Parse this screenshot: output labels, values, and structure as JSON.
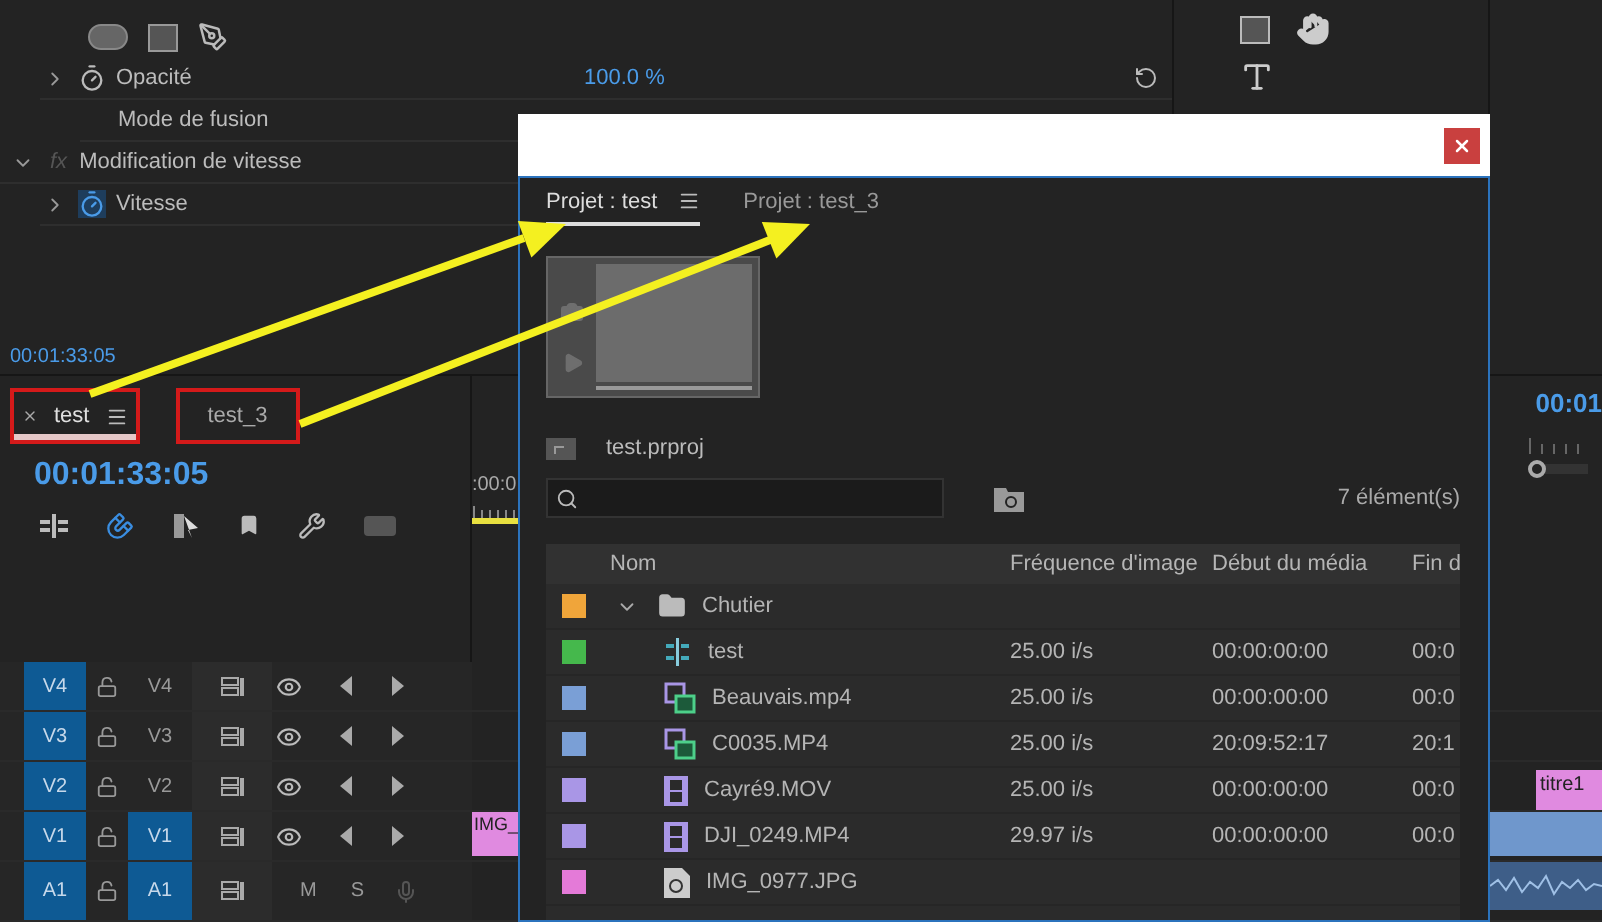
{
  "effect_controls": {
    "rows": [
      {
        "kind": "shapes"
      },
      {
        "kind": "param",
        "label": "Opacité",
        "value": "100.0 %",
        "expanded": false,
        "animated": false
      },
      {
        "kind": "plain",
        "label": "Mode de fusion"
      },
      {
        "kind": "effect",
        "badge": "fx",
        "label": "Modification de vitesse",
        "expanded": true
      },
      {
        "kind": "param",
        "label": "Vitesse",
        "expanded": false,
        "animated": true
      }
    ],
    "timecode": "00:01:33:05"
  },
  "timeline": {
    "tabs": [
      {
        "label": "test",
        "selected": true
      },
      {
        "label": "test_3",
        "selected": false
      }
    ],
    "timecode": "00:01:33:05",
    "ruler": ":00:0",
    "tracks": [
      {
        "kind": "video",
        "source": "V4",
        "name": "V4",
        "targeted": false
      },
      {
        "kind": "video",
        "source": "V3",
        "name": "V3",
        "targeted": false
      },
      {
        "kind": "video",
        "source": "V2",
        "name": "V2",
        "targeted": false
      },
      {
        "kind": "video",
        "source": "V1",
        "name": "V1",
        "targeted": true
      },
      {
        "kind": "audio",
        "source": "A1",
        "name": "A1",
        "targeted": true,
        "mute": "M",
        "solo": "S"
      }
    ],
    "clip": "IMG_"
  },
  "program_monitor": {
    "timecode": "00:01",
    "zoom_slider": {
      "level": 0
    },
    "clip": "titre1"
  },
  "project_window": {
    "tabs": [
      {
        "label": "Projet : test",
        "selected": true
      },
      {
        "label": "Projet : test_3",
        "selected": false
      }
    ],
    "file": "test.prproj",
    "item_count": "7 élément(s)",
    "columns": [
      "Nom",
      "Fréquence d'image",
      "Début du média",
      "Fin d"
    ],
    "rows": [
      {
        "kind": "bin",
        "name": "Chutier",
        "color": "#f0a53a",
        "expanded": true,
        "children": [
          {
            "kind": "sequence",
            "name": "test",
            "color": "#45b84c",
            "fps": "25.00 i/s",
            "start": "00:00:00:00",
            "end": "00:0"
          },
          {
            "kind": "av_clip",
            "name": "Beauvais.mp4",
            "color": "#7a9fd6",
            "fps": "25.00 i/s",
            "start": "00:00:00:00",
            "end": "00:0"
          },
          {
            "kind": "av_clip",
            "name": "C0035.MP4",
            "color": "#7a9fd6",
            "fps": "25.00 i/s",
            "start": "20:09:52:17",
            "end": "20:1"
          },
          {
            "kind": "video_clip",
            "name": "Cayré9.MOV",
            "color": "#a996e6",
            "fps": "25.00 i/s",
            "start": "00:00:00:00",
            "end": "00:0"
          },
          {
            "kind": "video_clip",
            "name": "DJI_0249.MP4",
            "color": "#a996e6",
            "fps": "29.97 i/s",
            "start": "00:00:00:00",
            "end": "00:0"
          },
          {
            "kind": "image",
            "name": "IMG_0977.JPG",
            "color": "#e47ad8"
          }
        ]
      }
    ]
  }
}
